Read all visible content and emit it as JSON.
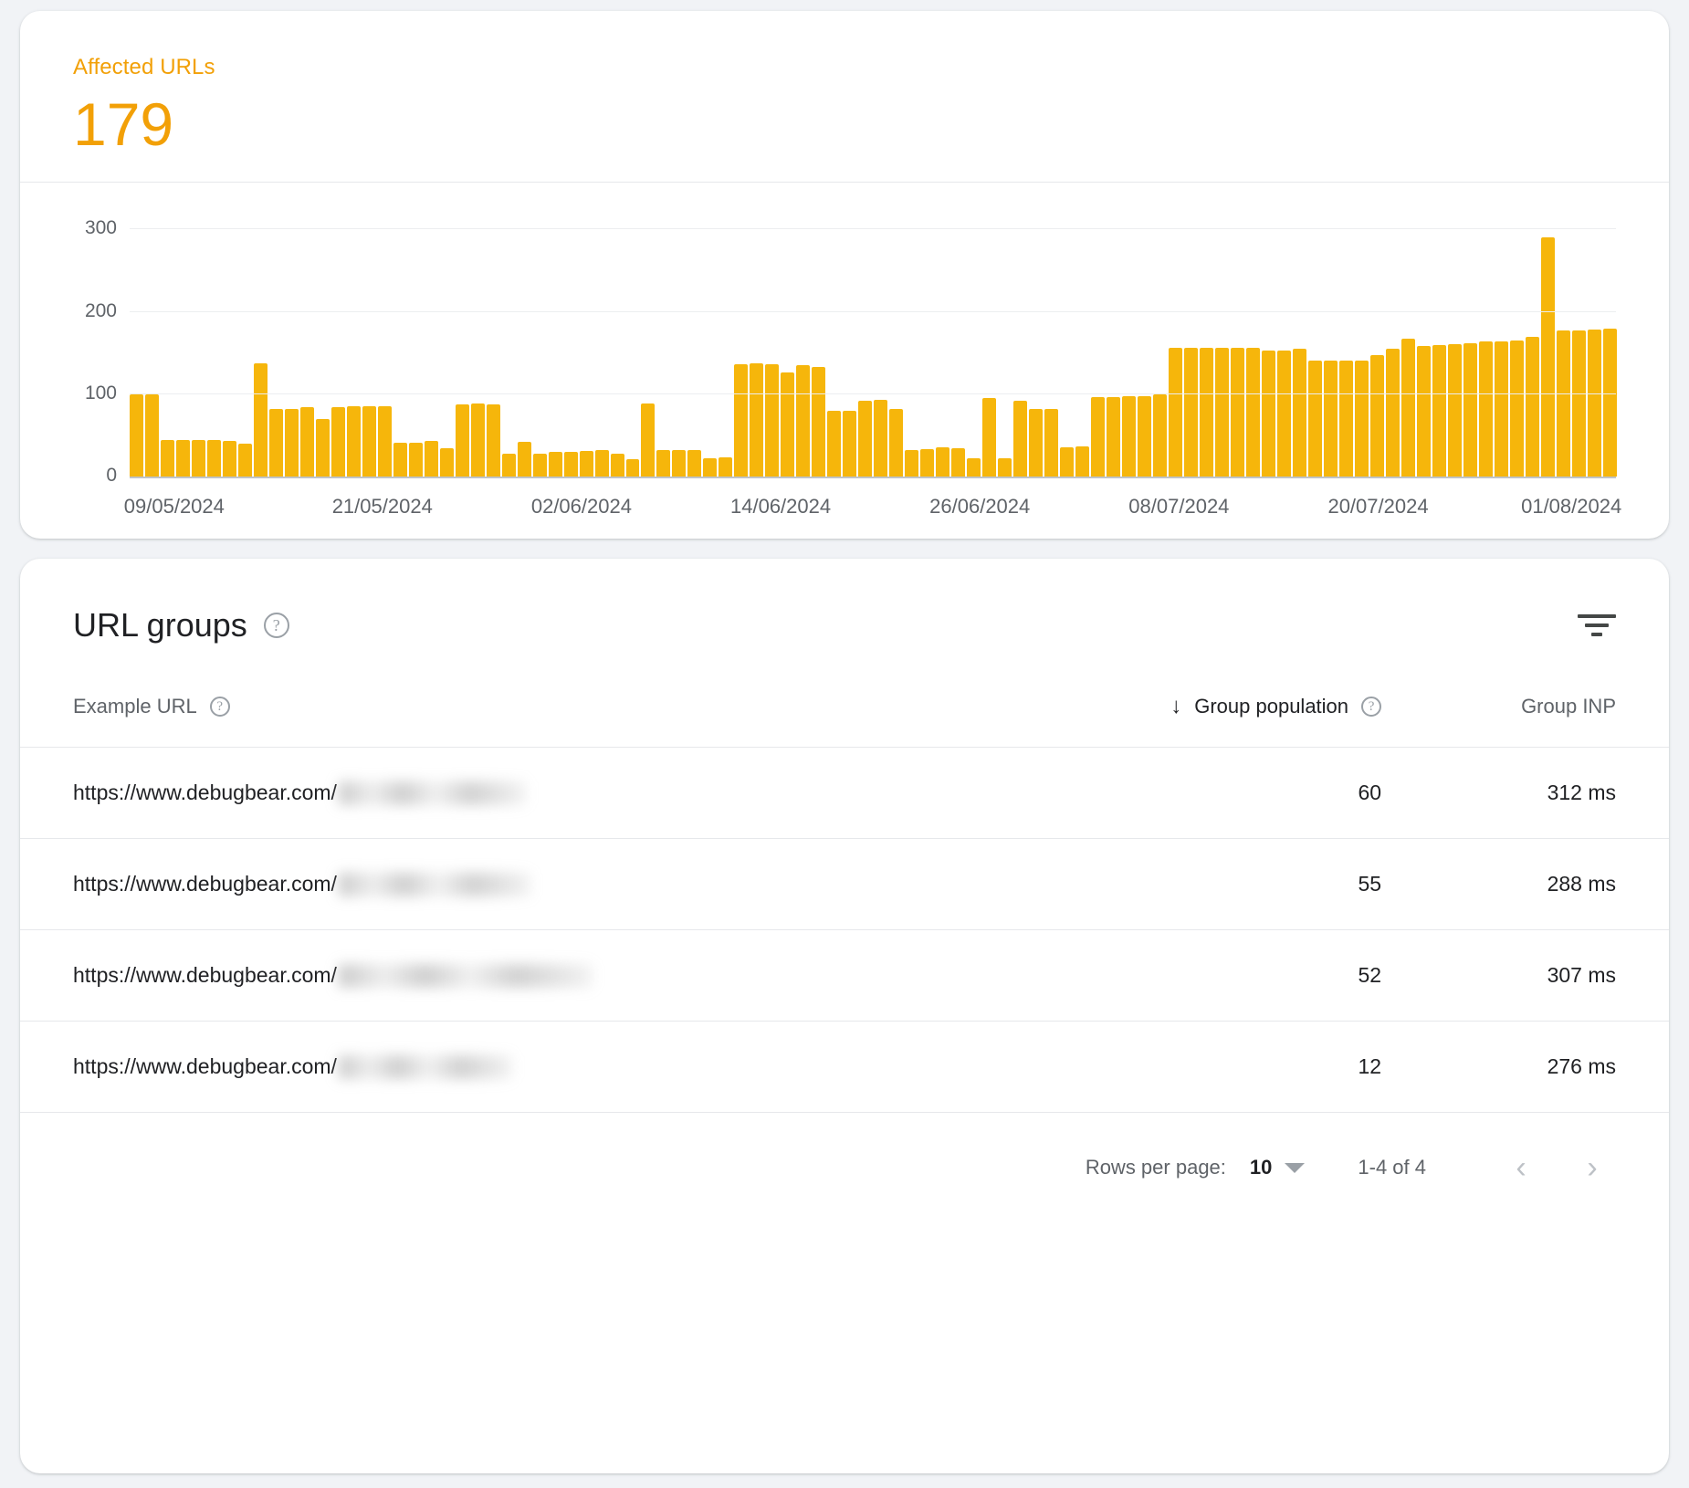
{
  "summary": {
    "label": "Affected URLs",
    "value": "179",
    "accent_color": "#f2a007"
  },
  "chart_data": {
    "type": "bar",
    "title": "Affected URLs",
    "xlabel": "",
    "ylabel": "",
    "ylim": [
      0,
      330
    ],
    "yticks": [
      "0",
      "100",
      "200",
      "300"
    ],
    "grid": true,
    "bar_color": "#f6b60b",
    "tick_labels": [
      "09/05/2024",
      "21/05/2024",
      "02/06/2024",
      "14/06/2024",
      "26/06/2024",
      "08/07/2024",
      "20/07/2024",
      "01/08/2024"
    ],
    "tick_positions_pct": [
      3.0,
      17.0,
      30.4,
      43.8,
      57.2,
      70.6,
      84.0,
      97.0
    ],
    "values": [
      100,
      100,
      45,
      45,
      45,
      45,
      43,
      40,
      138,
      82,
      82,
      84,
      70,
      84,
      86,
      86,
      86,
      41,
      41,
      44,
      35,
      88,
      89,
      88,
      28,
      42,
      28,
      30,
      30,
      31,
      33,
      28,
      21,
      89,
      32,
      32,
      32,
      23,
      24,
      137,
      138,
      137,
      127,
      136,
      133,
      80,
      80,
      92,
      93,
      82,
      33,
      34,
      36,
      35,
      22,
      96,
      22,
      92,
      82,
      82,
      36,
      37,
      97,
      97,
      98,
      98,
      100,
      156,
      156,
      156,
      157,
      157,
      157,
      153,
      153,
      155,
      141,
      141,
      141,
      141,
      148,
      155,
      168,
      159,
      160,
      161,
      162,
      164,
      164,
      165,
      170,
      291,
      177,
      178,
      179,
      180
    ]
  },
  "groups": {
    "title": "URL groups",
    "help_icon": "help-circle-icon",
    "filter_icon": "filter-icon",
    "columns": {
      "url": "Example URL",
      "population": "Group population",
      "inp": "Group INP",
      "sort_indicator": "↓"
    },
    "rows": [
      {
        "url_prefix": "https://www.debugbear.com/",
        "url_blur_width": 205,
        "population": "60",
        "inp": "312 ms"
      },
      {
        "url_prefix": "https://www.debugbear.com/",
        "url_blur_width": 210,
        "population": "55",
        "inp": "288 ms"
      },
      {
        "url_prefix": "https://www.debugbear.com/",
        "url_blur_width": 278,
        "population": "52",
        "inp": "307 ms"
      },
      {
        "url_prefix": "https://www.debugbear.com/",
        "url_blur_width": 190,
        "population": "12",
        "inp": "276 ms"
      }
    ],
    "pagination": {
      "rows_per_page_label": "Rows per page:",
      "rows_per_page_value": "10",
      "range": "1-4 of 4",
      "prev_icon": "chevron-left-icon",
      "next_icon": "chevron-right-icon"
    }
  }
}
